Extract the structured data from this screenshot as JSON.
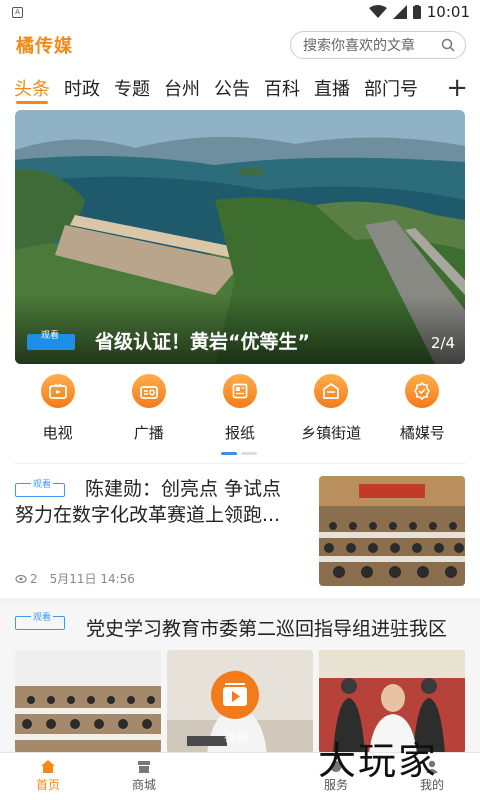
{
  "status_bar": {
    "time": "10:01",
    "sim_label": "A"
  },
  "header": {
    "logo": "橘传媒",
    "search_placeholder": "搜索你喜欢的文章"
  },
  "tabs": [
    {
      "label": "头条",
      "active": true
    },
    {
      "label": "时政"
    },
    {
      "label": "专题"
    },
    {
      "label": "台州"
    },
    {
      "label": "公告"
    },
    {
      "label": "百科"
    },
    {
      "label": "直播"
    },
    {
      "label": "部门号"
    }
  ],
  "tab_add": "+",
  "banner": {
    "badge": "观看",
    "title": "省级认证！黄岩“优等生”",
    "pager": "2/4"
  },
  "channels": [
    {
      "label": "电视",
      "icon": "tv-icon"
    },
    {
      "label": "广播",
      "icon": "radio-icon"
    },
    {
      "label": "报纸",
      "icon": "newspaper-icon"
    },
    {
      "label": "乡镇街道",
      "icon": "town-icon"
    },
    {
      "label": "橘媒号",
      "icon": "badge-icon"
    }
  ],
  "news": [
    {
      "tag": "观看",
      "title": "陈建勋：创亮点 争试点 努力在数字化改革赛道上领跑...",
      "views": "2",
      "date": "5月11日 14:56"
    },
    {
      "tag": "观看",
      "title": "党史学习教育市委第二巡回指导组进驻我区",
      "video_label": "视频"
    }
  ],
  "bottom_nav": [
    {
      "label": "首页",
      "icon": "home-icon",
      "active": true
    },
    {
      "label": "商城",
      "icon": "shop-icon"
    },
    {
      "label": "",
      "icon": ""
    },
    {
      "label": "服务",
      "icon": "service-icon"
    },
    {
      "label": "我的",
      "icon": "profile-icon"
    }
  ],
  "watermark": "大玩家",
  "colors": {
    "accent": "#f28a1a",
    "tag_blue": "#3b9bf0"
  }
}
